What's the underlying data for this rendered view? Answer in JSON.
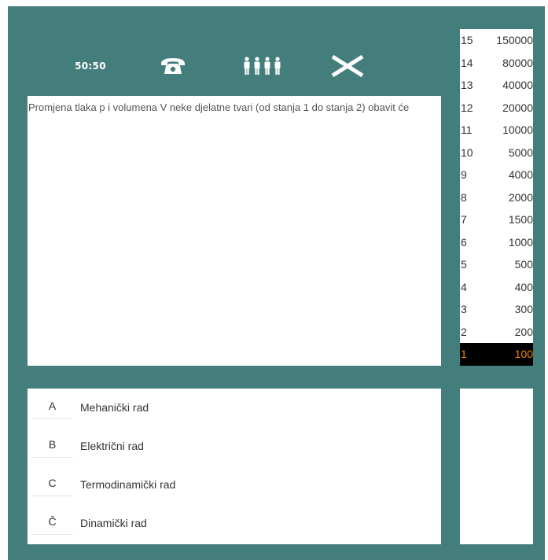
{
  "lifelines": {
    "fifty_fifty_label": "50:50",
    "phone_icon": "telephone-icon",
    "audience_icon": "audience-icon",
    "quit_icon": "close-icon",
    "color": "#ffffff"
  },
  "question": {
    "text": "Promjena tlaka p i volumena V neke djelatne tvari (od stanja 1 do stanja 2) obavit će"
  },
  "answers": [
    {
      "letter": "A",
      "text": "Mehanički rad"
    },
    {
      "letter": "B",
      "text": "Električni rad"
    },
    {
      "letter": "C",
      "text": "Termodinamički rad"
    },
    {
      "letter": "Č",
      "text": "Dinamički rad"
    }
  ],
  "prize_ladder": [
    {
      "level": "15",
      "amount": "150000"
    },
    {
      "level": "14",
      "amount": "80000"
    },
    {
      "level": "13",
      "amount": "40000"
    },
    {
      "level": "12",
      "amount": "20000"
    },
    {
      "level": "11",
      "amount": "10000"
    },
    {
      "level": "10",
      "amount": "5000"
    },
    {
      "level": "9",
      "amount": "4000"
    },
    {
      "level": "8",
      "amount": "2000"
    },
    {
      "level": "7",
      "amount": "1500"
    },
    {
      "level": "6",
      "amount": "1000"
    },
    {
      "level": "5",
      "amount": "500"
    },
    {
      "level": "4",
      "amount": "400"
    },
    {
      "level": "3",
      "amount": "300"
    },
    {
      "level": "2",
      "amount": "200"
    },
    {
      "level": "1",
      "amount": "100"
    }
  ],
  "current_level": "1",
  "colors": {
    "frame": "#447e7c",
    "current_bg": "#000000",
    "current_text": "#f28a00"
  }
}
